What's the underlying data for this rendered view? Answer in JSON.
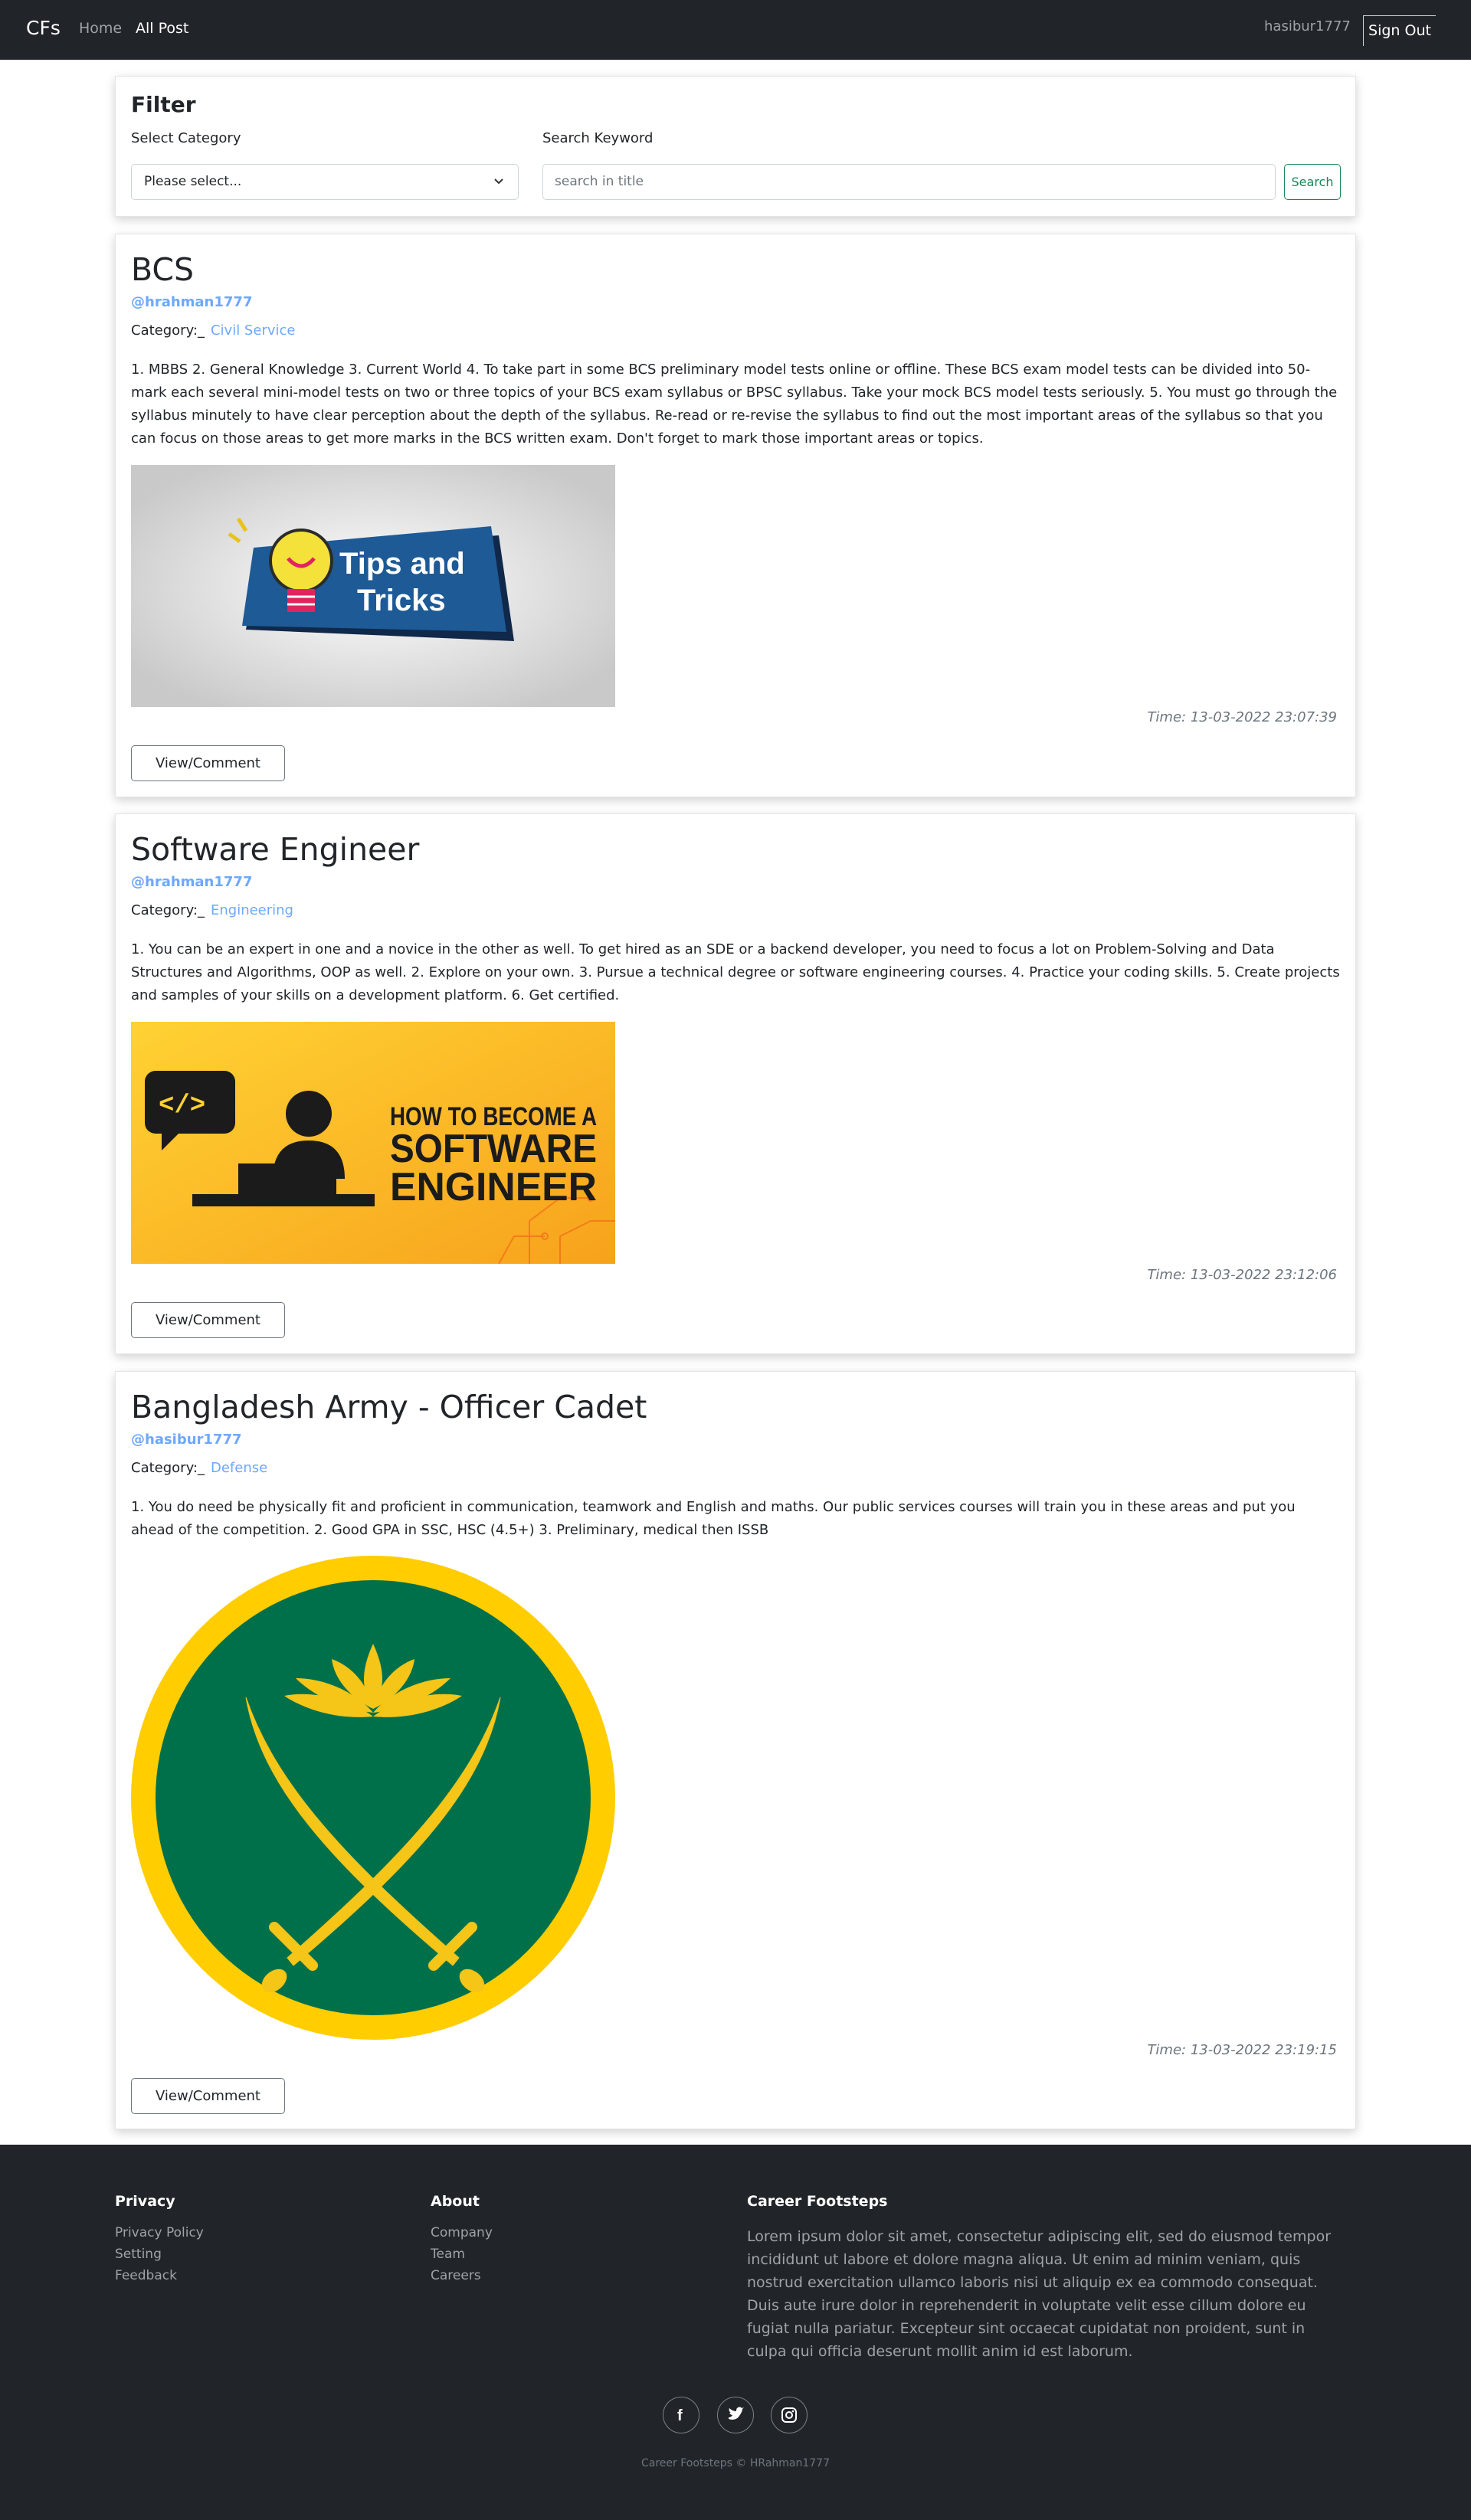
{
  "nav": {
    "brand": "CFs",
    "home": "Home",
    "all_post": "All Post",
    "username": "hasibur1777",
    "sign_out": "Sign Out"
  },
  "filter": {
    "title": "Filter",
    "category_label": "Select Category",
    "category_value": "Please select...",
    "keyword_label": "Search Keyword",
    "keyword_placeholder": "search in title",
    "search_button": "Search"
  },
  "posts": [
    {
      "title": "BCS",
      "author": "@hrahman1777",
      "category_label": "Category:_",
      "category": "Civil Service",
      "body": "1. MBBS 2. General Knowledge 3. Current World 4. To take part in some BCS preliminary model tests online or offline. These BCS exam model tests can be divided into 50-mark each several mini-model tests on two or three topics of your BCS exam syllabus or BPSC syllabus. Take your mock BCS model tests seriously. 5. You must go through the syllabus minutely to have clear perception about the depth of the syllabus. Re-read or re-revise the syllabus to find out the most important areas of the syllabus so that you can focus on those areas to get more marks in the BCS written exam. Don't forget to mark those important areas or topics.",
      "image_text": [
        "Tips and",
        "Tricks"
      ],
      "time": "Time: 13-03-2022 23:07:39",
      "button": "View/Comment"
    },
    {
      "title": "Software Engineer",
      "author": "@hrahman1777",
      "category_label": "Category:_",
      "category": "Engineering",
      "body": "1. You can be an expert in one and a novice in the other as well. To get hired as an SDE or a backend developer, you need to focus a lot on Problem-Solving and Data Structures and Algorithms, OOP as well. 2. Explore on your own. 3. Pursue a technical degree or software engineering courses. 4. Practice your coding skills. 5. Create projects and samples of your skills on a development platform. 6. Get certified.",
      "image_text": [
        "HOW TO BECOME A",
        "SOFTWARE",
        "ENGINEER"
      ],
      "time": "Time: 13-03-2022 23:12:06",
      "button": "View/Comment"
    },
    {
      "title": "Bangladesh Army - Officer Cadet",
      "author": "@hasibur1777",
      "category_label": "Category:_",
      "category": "Defense",
      "body": "1. You do need be physically fit and proficient in communication, teamwork and English and maths. Our public services courses will train you in these areas and put you ahead of the competition. 2. Good GPA in SSC, HSC (4.5+) 3. Preliminary, medical then ISSB",
      "time": "Time: 13-03-2022 23:19:15",
      "button": "View/Comment"
    }
  ],
  "footer": {
    "privacy_head": "Privacy",
    "privacy_links": [
      "Privacy Policy",
      "Setting",
      "Feedback"
    ],
    "about_head": "About",
    "about_links": [
      "Company",
      "Team",
      "Careers"
    ],
    "career_head": "Career Footsteps",
    "career_text": "Lorem ipsum dolor sit amet, consectetur adipiscing elit, sed do eiusmod tempor incididunt ut labore et dolore magna aliqua. Ut enim ad minim veniam, quis nostrud exercitation ullamco laboris nisi ut aliquip ex ea commodo consequat. Duis aute irure dolor in reprehenderit in voluptate velit esse cillum dolore eu fugiat nulla pariatur. Excepteur sint occaecat cupidatat non proident, sunt in culpa qui officia deserunt mollit anim id est laborum.",
    "copyright": "Career Footsteps © HRahman1777"
  },
  "icons": {
    "facebook": "facebook-icon",
    "twitter": "twitter-icon",
    "instagram": "instagram-icon"
  },
  "colors": {
    "navbar": "#212529",
    "link": "#6ea8fe",
    "search_green": "#198754"
  }
}
